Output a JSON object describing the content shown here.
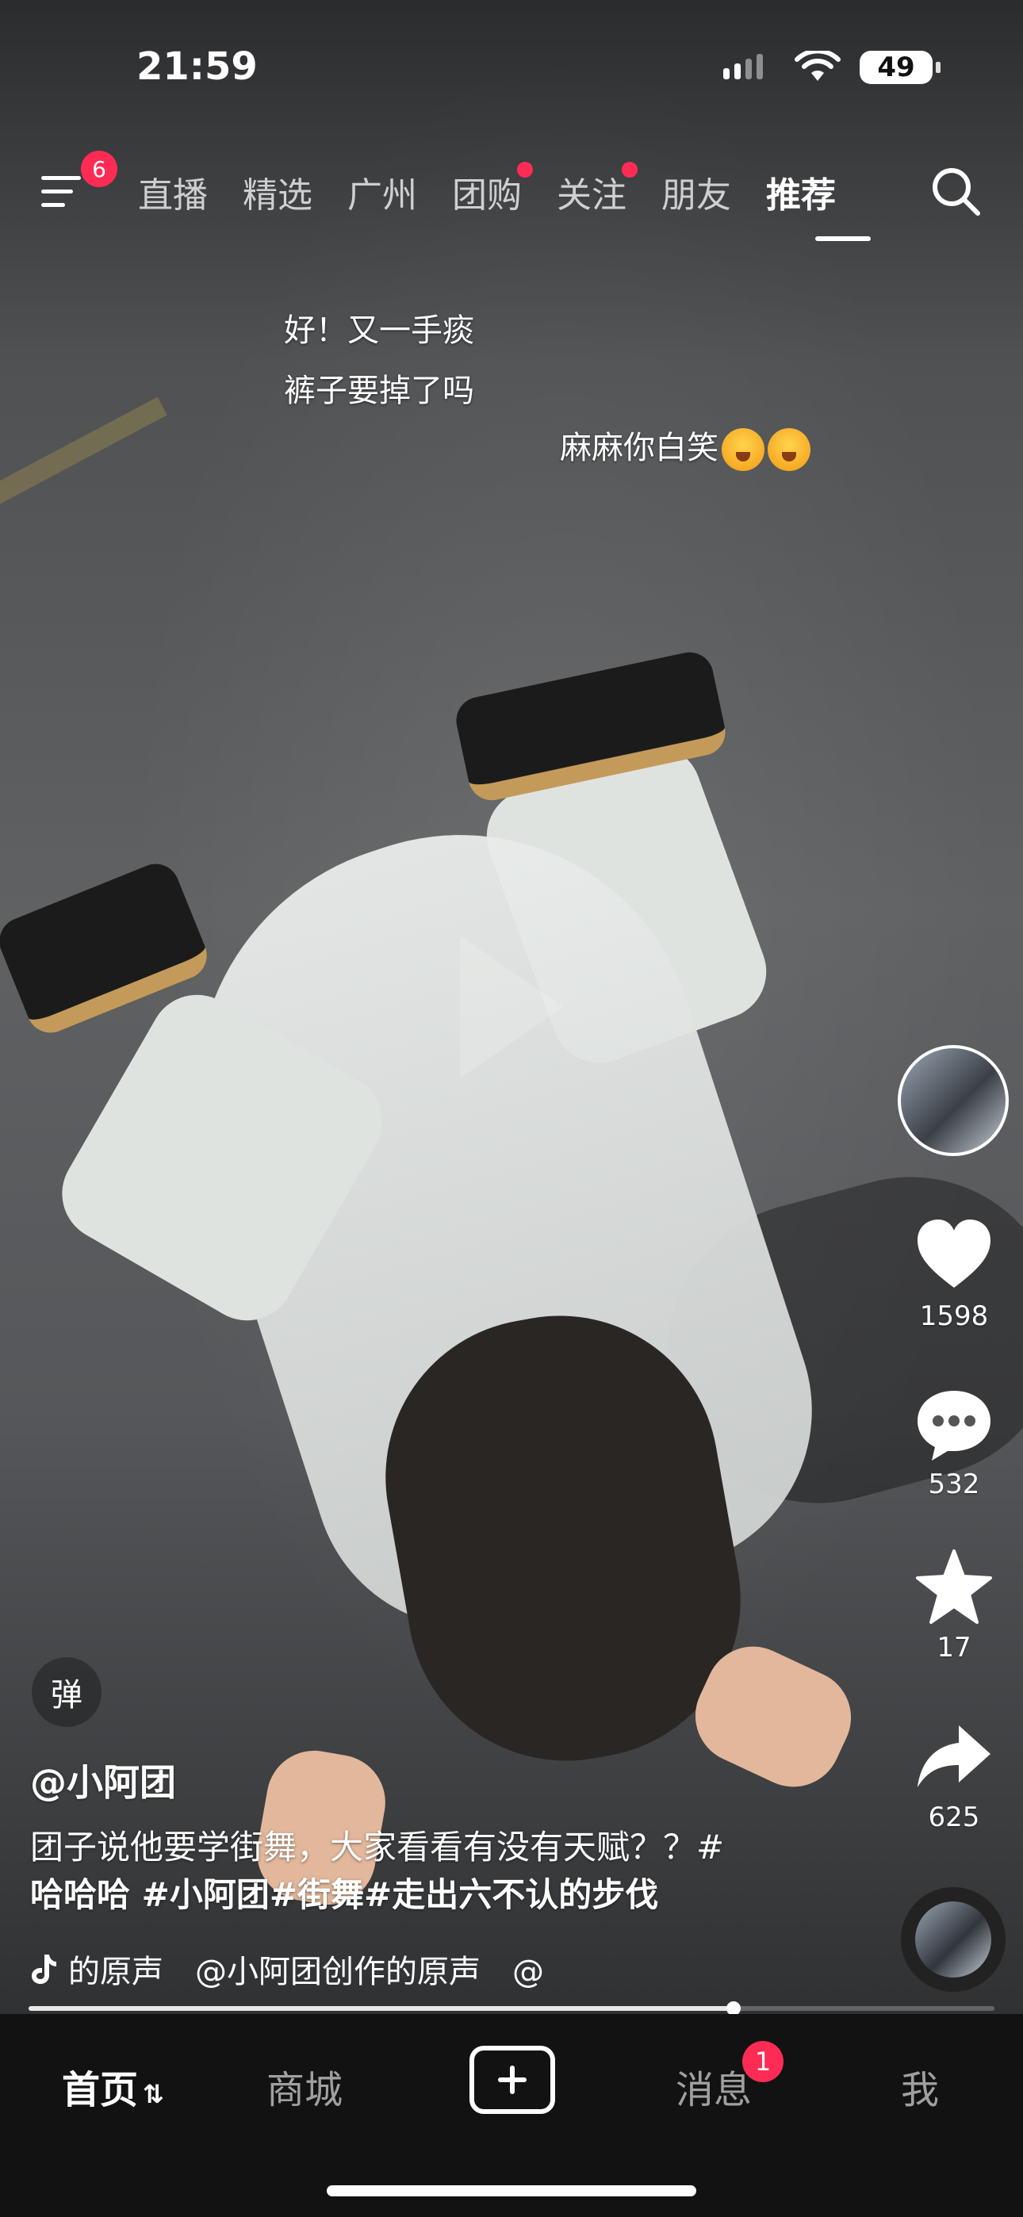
{
  "status_bar": {
    "time": "21:59",
    "battery": "49"
  },
  "top_nav": {
    "menu_badge": "6",
    "tabs": [
      {
        "label": "直播",
        "dot": false
      },
      {
        "label": "精选",
        "dot": false
      },
      {
        "label": "广州",
        "dot": false
      },
      {
        "label": "团购",
        "dot": true
      },
      {
        "label": "关注",
        "dot": true
      },
      {
        "label": "朋友",
        "dot": false
      },
      {
        "label": "推荐",
        "dot": false,
        "active": true
      }
    ]
  },
  "danmaku": [
    {
      "text": "好！又一手痰"
    },
    {
      "text": "裤子要掉了吗"
    },
    {
      "text": "麻麻你白笑"
    }
  ],
  "right_rail": {
    "likes": "1598",
    "comments": "532",
    "favorites": "17",
    "shares": "625"
  },
  "video_info": {
    "danmu_toggle": "弹",
    "author": "@小阿团",
    "description": "团子说他要学街舞，大家看看有没有天赋？？#",
    "tags": "哈哈哈 #小阿团#街舞#走出六不认的步伐",
    "music": "的原声　@小阿团创作的原声　@",
    "progress": 0.73
  },
  "tab_bar": {
    "home": "首页",
    "mall": "商城",
    "messages": "消息",
    "messages_badge": "1",
    "me": "我"
  },
  "colors": {
    "accent": "#fe2c55",
    "tabbar_bg": "#121212"
  }
}
